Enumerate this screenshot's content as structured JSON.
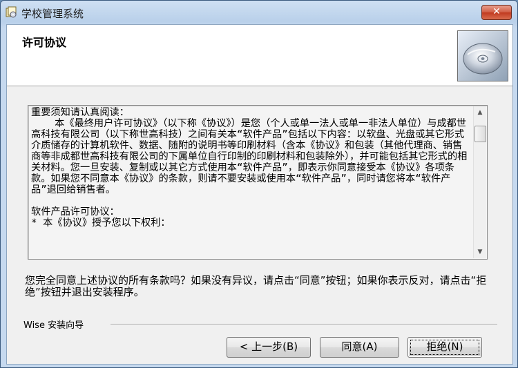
{
  "window": {
    "title": "学校管理系统",
    "close_label": "✕"
  },
  "header": {
    "title": "许可协议",
    "icon": "cd-disc-icon"
  },
  "license": {
    "text": "重要须知请认真阅读：\n    本《最终用户许可协议》（以下称《协议》）是您（个人或单一法人或单一非法人单位）与成都世高科技有限公司（以下称世高科技）之间有关本“软件产品”包括以下内容：以软盘、光盘或其它形式介质储存的计算机软件、数据、随附的说明书等印刷材料（含本《协议》和包装（其他代理商、销售商等非成都世高科技有限公司的下属单位自行印制的印刷材料和包装除外），并可能包括其它形式的相关材料。您一旦安装、复制或以其它方式使用本“软件产品”，即表示你同意接受本《协议》各项条款。如果您不同意本《协议》的条款，则请不要安装或使用本“软件产品”，同时请您将本“软件产品”退回给销售者。\n\n软件产品许可协议：\n* 本《协议》授予您以下权利："
  },
  "question": "您完全同意上述协议的所有条款吗？如果没有异议，请点击“同意”按钮；如果你表示反对，请点击“拒绝”按钮并退出安装程序。",
  "footer": {
    "wizard_label": "Wise 安装向导",
    "back_label": "< 上一步(B)",
    "agree_label": "同意(A)",
    "reject_label": "拒绝(N)"
  },
  "colors": {
    "title_bar": "#c6d9ef",
    "close_button": "#c0391f",
    "dialog_bg": "#f0f0f0"
  }
}
